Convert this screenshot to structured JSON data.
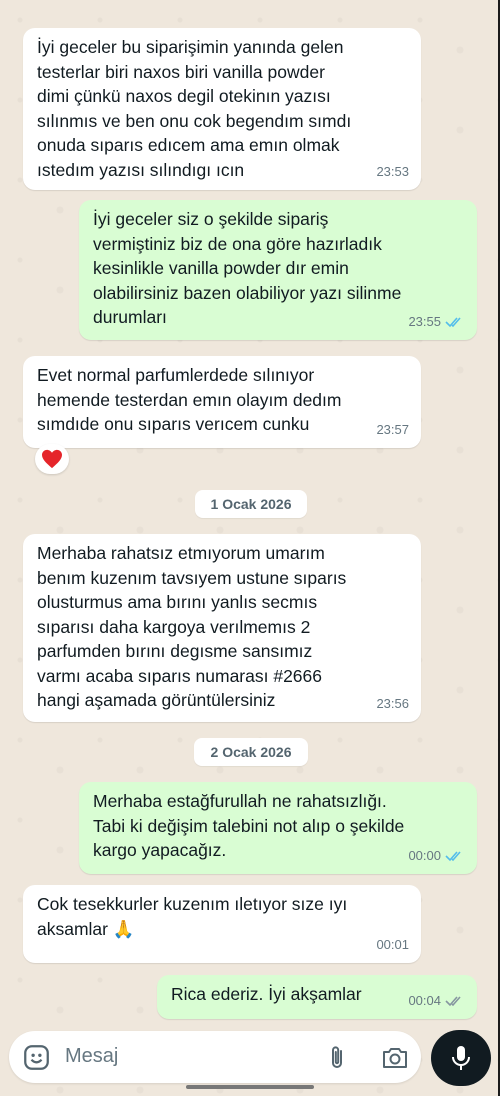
{
  "messages": [
    {
      "dir": "in",
      "text": "İyi geceler bu siparişimin yanında gelen\ntesterlar biri naxos biri vanilla powder\ndimi çünkü naxos degil otekinın yazısı\nsılınmıs ve ben onu cok begendım sımdı\nonuda sıparıs edıcem ama emın olmak\nıstedım yazısı sılındıgı ıcın",
      "time": "23:53"
    },
    {
      "dir": "out",
      "text": "İyi geceler siz o şekilde sipariş\nvermiştiniz biz de ona göre hazırladık\nkesinlikle vanilla powder dır emin\nolabilirsiniz bazen olabiliyor yazı silinme\ndurumları",
      "time": "23:55"
    },
    {
      "dir": "in",
      "text": "Evet normal parfumlerdede sılınıyor\nhemende testerdan emın olayım dedım\nsımdıde onu sıparıs verıcem cunku",
      "time": "23:57"
    },
    {
      "dir": "in",
      "text": "Merhaba rahatsız etmıyorum umarım\nbenım kuzenım tavsıyem ustune sıparıs\nolusturmus ama bırını yanlıs secmıs\nsıparısı daha kargoya verılmemıs 2\nparfumden bırını degısme sansımız\nvarmı acaba sıparıs numarası #2666\nhangi aşamada görüntülersiniz",
      "time": "23:56"
    },
    {
      "dir": "out",
      "text": "Merhaba estağfurullah ne rahatsızlığı.\nTabi ki değişim talebini not alıp o şekilde\nkargo yapacağız.",
      "time": "00:00"
    },
    {
      "dir": "in",
      "text": "Cok tesekkurler kuzenım ıletıyor sıze ıyı\naksamlar 🙏",
      "time": "00:01"
    },
    {
      "dir": "out",
      "text": "Rica ederiz. İyi akşamlar",
      "time": "00:04"
    }
  ],
  "dates": [
    "1 Ocak 2026",
    "2 Ocak 2026"
  ],
  "reaction": "heart-emoji",
  "input": {
    "placeholder": "Mesaj"
  },
  "icons": [
    "emoji-icon",
    "attach-icon",
    "camera-icon",
    "mic-icon",
    "double-check-icon"
  ],
  "colors": {
    "incoming": "#ffffff",
    "outgoing": "#d9fdd3",
    "read_ticks": "#53bdeb",
    "mic_button": "#111b21"
  }
}
